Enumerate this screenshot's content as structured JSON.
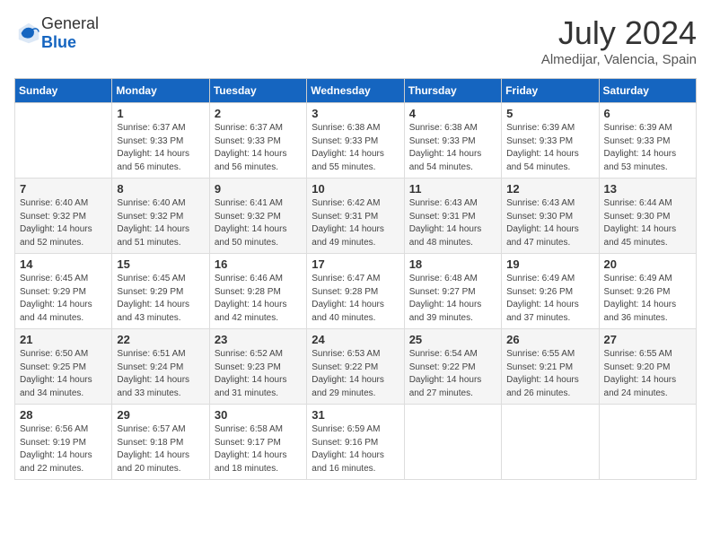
{
  "logo": {
    "general": "General",
    "blue": "Blue"
  },
  "title": {
    "month_year": "July 2024",
    "location": "Almedijar, Valencia, Spain"
  },
  "headers": [
    "Sunday",
    "Monday",
    "Tuesday",
    "Wednesday",
    "Thursday",
    "Friday",
    "Saturday"
  ],
  "weeks": [
    {
      "cells": [
        {
          "day": "",
          "content": ""
        },
        {
          "day": "1",
          "content": "Sunrise: 6:37 AM\nSunset: 9:33 PM\nDaylight: 14 hours\nand 56 minutes."
        },
        {
          "day": "2",
          "content": "Sunrise: 6:37 AM\nSunset: 9:33 PM\nDaylight: 14 hours\nand 56 minutes."
        },
        {
          "day": "3",
          "content": "Sunrise: 6:38 AM\nSunset: 9:33 PM\nDaylight: 14 hours\nand 55 minutes."
        },
        {
          "day": "4",
          "content": "Sunrise: 6:38 AM\nSunset: 9:33 PM\nDaylight: 14 hours\nand 54 minutes."
        },
        {
          "day": "5",
          "content": "Sunrise: 6:39 AM\nSunset: 9:33 PM\nDaylight: 14 hours\nand 54 minutes."
        },
        {
          "day": "6",
          "content": "Sunrise: 6:39 AM\nSunset: 9:33 PM\nDaylight: 14 hours\nand 53 minutes."
        }
      ]
    },
    {
      "cells": [
        {
          "day": "7",
          "content": "Sunrise: 6:40 AM\nSunset: 9:32 PM\nDaylight: 14 hours\nand 52 minutes."
        },
        {
          "day": "8",
          "content": "Sunrise: 6:40 AM\nSunset: 9:32 PM\nDaylight: 14 hours\nand 51 minutes."
        },
        {
          "day": "9",
          "content": "Sunrise: 6:41 AM\nSunset: 9:32 PM\nDaylight: 14 hours\nand 50 minutes."
        },
        {
          "day": "10",
          "content": "Sunrise: 6:42 AM\nSunset: 9:31 PM\nDaylight: 14 hours\nand 49 minutes."
        },
        {
          "day": "11",
          "content": "Sunrise: 6:43 AM\nSunset: 9:31 PM\nDaylight: 14 hours\nand 48 minutes."
        },
        {
          "day": "12",
          "content": "Sunrise: 6:43 AM\nSunset: 9:30 PM\nDaylight: 14 hours\nand 47 minutes."
        },
        {
          "day": "13",
          "content": "Sunrise: 6:44 AM\nSunset: 9:30 PM\nDaylight: 14 hours\nand 45 minutes."
        }
      ]
    },
    {
      "cells": [
        {
          "day": "14",
          "content": "Sunrise: 6:45 AM\nSunset: 9:29 PM\nDaylight: 14 hours\nand 44 minutes."
        },
        {
          "day": "15",
          "content": "Sunrise: 6:45 AM\nSunset: 9:29 PM\nDaylight: 14 hours\nand 43 minutes."
        },
        {
          "day": "16",
          "content": "Sunrise: 6:46 AM\nSunset: 9:28 PM\nDaylight: 14 hours\nand 42 minutes."
        },
        {
          "day": "17",
          "content": "Sunrise: 6:47 AM\nSunset: 9:28 PM\nDaylight: 14 hours\nand 40 minutes."
        },
        {
          "day": "18",
          "content": "Sunrise: 6:48 AM\nSunset: 9:27 PM\nDaylight: 14 hours\nand 39 minutes."
        },
        {
          "day": "19",
          "content": "Sunrise: 6:49 AM\nSunset: 9:26 PM\nDaylight: 14 hours\nand 37 minutes."
        },
        {
          "day": "20",
          "content": "Sunrise: 6:49 AM\nSunset: 9:26 PM\nDaylight: 14 hours\nand 36 minutes."
        }
      ]
    },
    {
      "cells": [
        {
          "day": "21",
          "content": "Sunrise: 6:50 AM\nSunset: 9:25 PM\nDaylight: 14 hours\nand 34 minutes."
        },
        {
          "day": "22",
          "content": "Sunrise: 6:51 AM\nSunset: 9:24 PM\nDaylight: 14 hours\nand 33 minutes."
        },
        {
          "day": "23",
          "content": "Sunrise: 6:52 AM\nSunset: 9:23 PM\nDaylight: 14 hours\nand 31 minutes."
        },
        {
          "day": "24",
          "content": "Sunrise: 6:53 AM\nSunset: 9:22 PM\nDaylight: 14 hours\nand 29 minutes."
        },
        {
          "day": "25",
          "content": "Sunrise: 6:54 AM\nSunset: 9:22 PM\nDaylight: 14 hours\nand 27 minutes."
        },
        {
          "day": "26",
          "content": "Sunrise: 6:55 AM\nSunset: 9:21 PM\nDaylight: 14 hours\nand 26 minutes."
        },
        {
          "day": "27",
          "content": "Sunrise: 6:55 AM\nSunset: 9:20 PM\nDaylight: 14 hours\nand 24 minutes."
        }
      ]
    },
    {
      "cells": [
        {
          "day": "28",
          "content": "Sunrise: 6:56 AM\nSunset: 9:19 PM\nDaylight: 14 hours\nand 22 minutes."
        },
        {
          "day": "29",
          "content": "Sunrise: 6:57 AM\nSunset: 9:18 PM\nDaylight: 14 hours\nand 20 minutes."
        },
        {
          "day": "30",
          "content": "Sunrise: 6:58 AM\nSunset: 9:17 PM\nDaylight: 14 hours\nand 18 minutes."
        },
        {
          "day": "31",
          "content": "Sunrise: 6:59 AM\nSunset: 9:16 PM\nDaylight: 14 hours\nand 16 minutes."
        },
        {
          "day": "",
          "content": ""
        },
        {
          "day": "",
          "content": ""
        },
        {
          "day": "",
          "content": ""
        }
      ]
    }
  ]
}
